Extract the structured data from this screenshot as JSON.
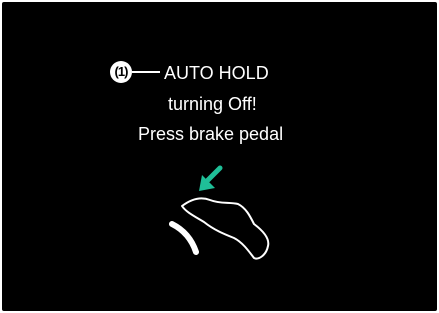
{
  "screen": {
    "callout_number": "(1)",
    "lines": [
      "AUTO HOLD",
      "turning Off!",
      "Press brake pedal"
    ]
  },
  "icons": {
    "arrow": "arrow-down-left-icon",
    "foot": "foot-on-brake-pedal-icon",
    "pedal": "brake-pedal-arc-icon"
  },
  "colors": {
    "background": "#000000",
    "text": "#ffffff",
    "arrow": "#1fbf98"
  }
}
